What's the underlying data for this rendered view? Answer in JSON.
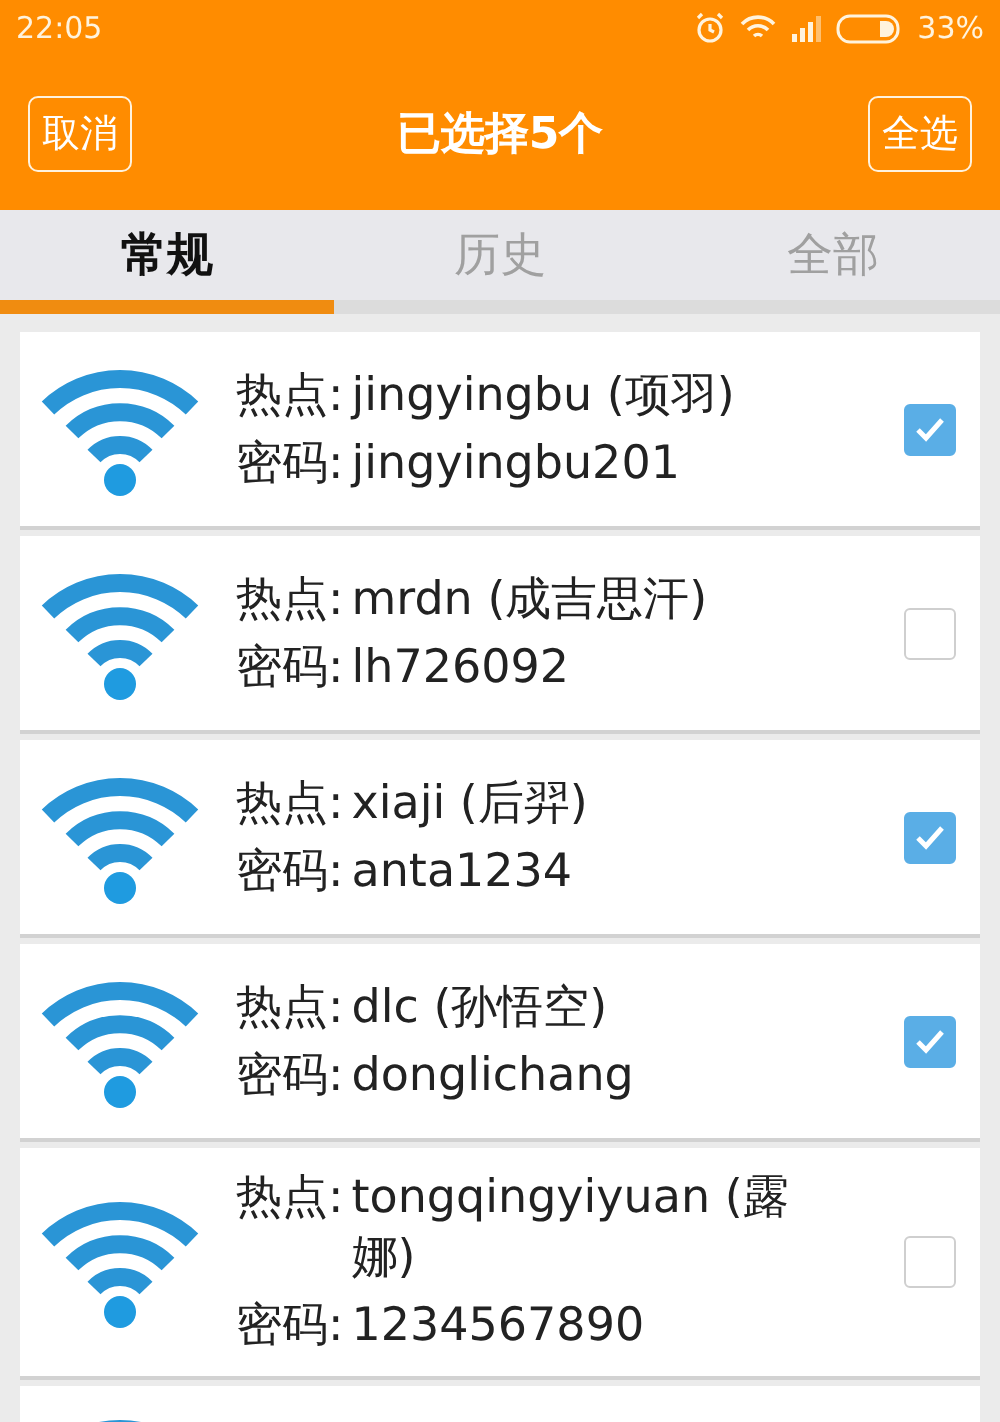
{
  "status_bar": {
    "time": "22:05",
    "battery": "33%"
  },
  "header": {
    "cancel": "取消",
    "title": "已选择5个",
    "select_all": "全选"
  },
  "tabs": [
    {
      "label": "常规",
      "selected": true
    },
    {
      "label": "历史",
      "selected": false
    },
    {
      "label": "全部",
      "selected": false
    }
  ],
  "hotspots": [
    {
      "ssid_label": "热点:",
      "ssid": "jingyingbu (项羽)",
      "password_label": "密码:",
      "password": "jingyingbu201",
      "checked": true
    },
    {
      "ssid_label": "热点:",
      "ssid": "mrdn (成吉思汗)",
      "password_label": "密码:",
      "password": "lh726092",
      "checked": false
    },
    {
      "ssid_label": "热点:",
      "ssid": "xiaji (后羿)",
      "password_label": "密码:",
      "password": "anta1234",
      "checked": true
    },
    {
      "ssid_label": "热点:",
      "ssid": "dlc (孙悟空)",
      "password_label": "密码:",
      "password": "donglichang",
      "checked": true
    },
    {
      "ssid_label": "热点:",
      "ssid": "tongqingyiyuan (露娜)",
      "password_label": "密码:",
      "password": "1234567890",
      "checked": false
    }
  ]
}
